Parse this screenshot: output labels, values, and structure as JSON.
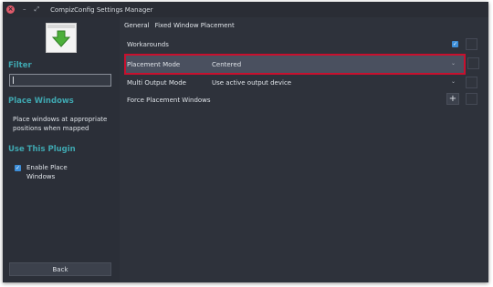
{
  "window": {
    "title": "CompizConfig Settings Manager",
    "close_glyph": "×",
    "minimize_glyph": "–",
    "maximize_glyph": "⤢"
  },
  "sidebar": {
    "plugin_icon": "green-down-arrow-icon",
    "filter_title": "Filter",
    "filter_value": "",
    "plugin_title": "Place Windows",
    "description": "Place windows at appropriate positions when mapped",
    "use_plugin_title": "Use This Plugin",
    "enable_label": "Enable Place Windows",
    "enable_checked": true,
    "back_label": "Back"
  },
  "tabs": [
    {
      "label": "General"
    },
    {
      "label": "Fixed Window Placement"
    }
  ],
  "settings": {
    "workarounds": {
      "label": "Workarounds",
      "checked": true
    },
    "placement_mode": {
      "label": "Placement Mode",
      "value": "Centered"
    },
    "multi_output_mode": {
      "label": "Multi Output Mode",
      "value": "Use active output device"
    },
    "force_placement": {
      "label": "Force Placement Windows",
      "add_glyph": "+"
    }
  },
  "colors": {
    "accent": "#3fa7b0",
    "highlight_border": "#c8102e",
    "checkbox": "#3d8ed8"
  }
}
